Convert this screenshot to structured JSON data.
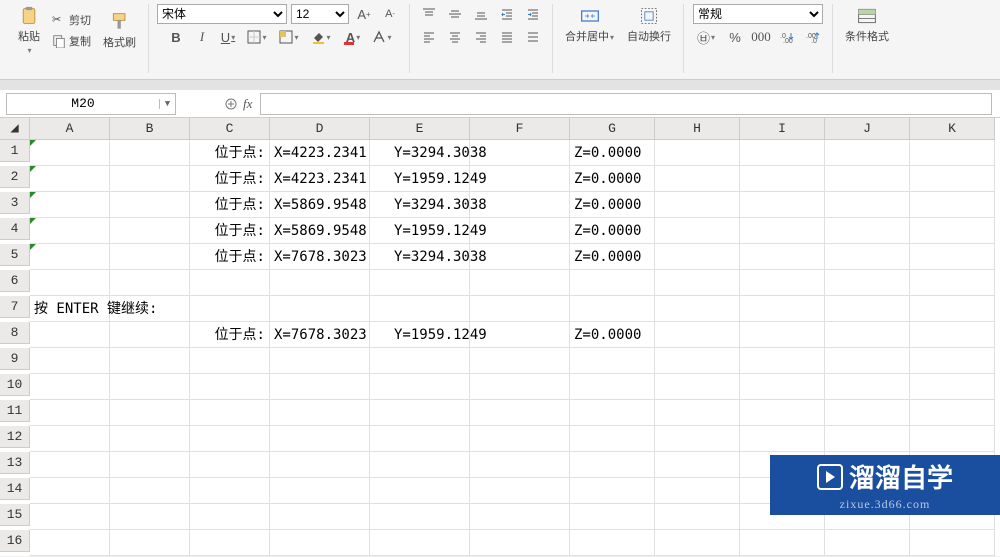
{
  "ribbon": {
    "clipboard": {
      "paste": "粘贴",
      "cut": "剪切",
      "copy": "复制",
      "format_painter": "格式刷"
    },
    "font": {
      "family": "宋体",
      "size": "12",
      "bold": "B",
      "italic": "I",
      "underline": "U"
    },
    "align": {
      "merge_center": "合并居中",
      "wrap_text": "自动换行"
    },
    "number": {
      "format": "常规"
    },
    "conditional": "条件格式"
  },
  "namebox": "M20",
  "formula": "",
  "columns": [
    "A",
    "B",
    "C",
    "D",
    "E",
    "F",
    "G",
    "H",
    "I",
    "J",
    "K"
  ],
  "rows": [
    "1",
    "2",
    "3",
    "4",
    "5",
    "6",
    "7",
    "8",
    "9",
    "10",
    "11",
    "12",
    "13",
    "14",
    "15",
    "16"
  ],
  "cells": {
    "r1": {
      "C": "位于点:",
      "D": "X=4223.2341",
      "E": "Y=3294.3038",
      "F": "Z=0.0000"
    },
    "r2": {
      "C": "位于点:",
      "D": "X=4223.2341",
      "E": "Y=1959.1249",
      "F": "Z=0.0000"
    },
    "r3": {
      "C": "位于点:",
      "D": "X=5869.9548",
      "E": "Y=3294.3038",
      "F": "Z=0.0000"
    },
    "r4": {
      "C": "位于点:",
      "D": "X=5869.9548",
      "E": "Y=1959.1249",
      "F": "Z=0.0000"
    },
    "r5": {
      "C": "位于点:",
      "D": "X=7678.3023",
      "E": "Y=3294.3038",
      "F": "Z=0.0000"
    },
    "r7": {
      "A": "按 ENTER 键继续:"
    },
    "r8": {
      "C": "位于点:",
      "D": "X=7678.3023",
      "E": "Y=1959.1249",
      "F": "Z=0.0000"
    }
  },
  "watermark": {
    "brand": "溜溜自学",
    "url": "zixue.3d66.com"
  }
}
